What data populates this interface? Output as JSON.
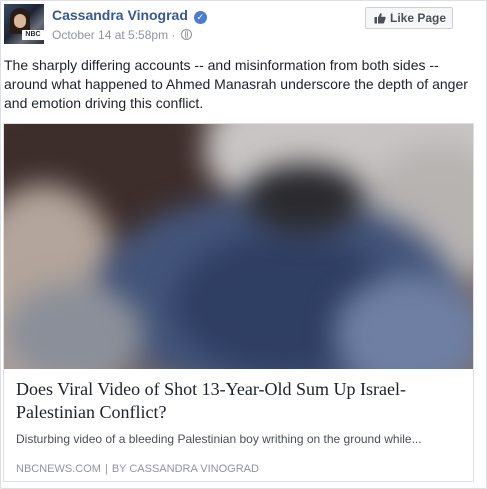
{
  "post": {
    "author": "Cassandra Vinograd",
    "timestamp": "October 14 at 5:58pm",
    "meta_separator": "·",
    "verified_mark": "✓",
    "body": "The sharply differing accounts -- and misinformation from both sides -- around what happened to Ahmed Manasrah underscore the depth of anger and emotion driving this conflict.",
    "avatar_tag": "NBC",
    "like_button_label": "Like Page"
  },
  "link_card": {
    "title": "Does Viral Video of Shot 13-Year-Old Sum Up Israel-Palestinian Conflict?",
    "description": "Disturbing video of a bleeding Palestinian boy writhing on the ground while...",
    "source_domain": "NBCNEWS.COM",
    "source_separator": "|",
    "byline": "BY CASSANDRA VINOGRAD"
  },
  "icons": {
    "verified": "verified-badge-icon",
    "privacy": "globe-icon",
    "like": "thumbs-up-icon"
  },
  "colors": {
    "author_link": "#365899",
    "meta_text": "#90949c",
    "verified_badge": "#4b7bd3",
    "body_text": "#1d2129"
  }
}
